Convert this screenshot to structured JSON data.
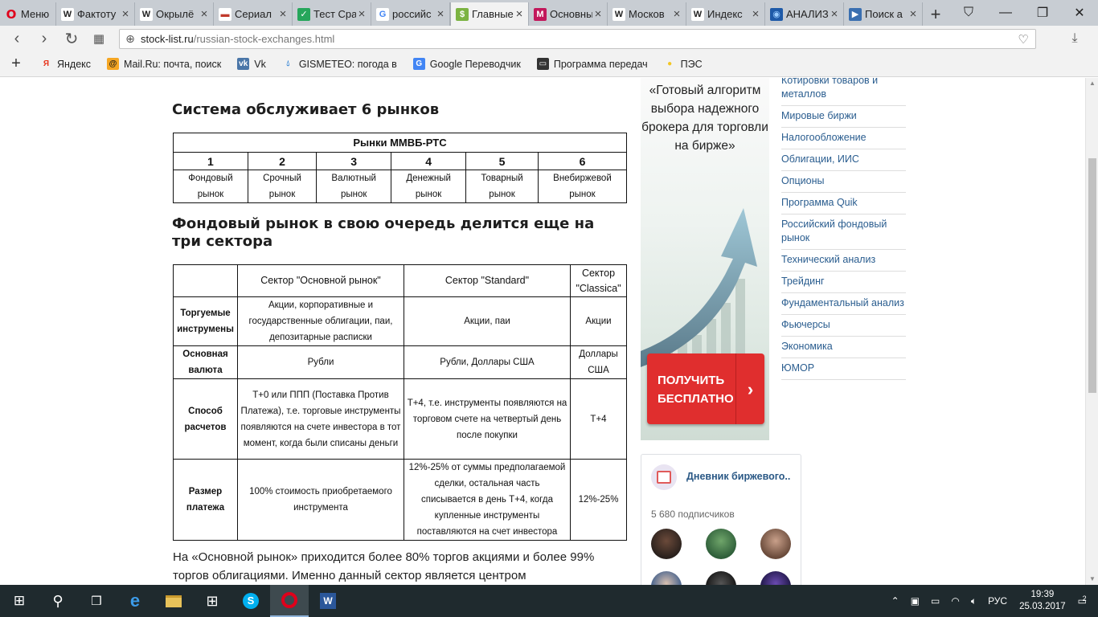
{
  "browser": {
    "menu_label": "Меню",
    "tabs": [
      {
        "label": "Фактоту",
        "icon": "W"
      },
      {
        "label": "Окрылё",
        "icon": "W"
      },
      {
        "label": "Сериал",
        "icon": "flag"
      },
      {
        "label": "Тест Сра",
        "icon": "check"
      },
      {
        "label": "российс",
        "icon": "G"
      },
      {
        "label": "Главные",
        "icon": "$"
      },
      {
        "label": "Основны",
        "icon": "M"
      },
      {
        "label": "Москов",
        "icon": "W"
      },
      {
        "label": "Индекс",
        "icon": "W"
      },
      {
        "label": "АНАЛИЗ",
        "icon": "globe"
      },
      {
        "label": "Поиск а",
        "icon": "play"
      }
    ],
    "url_host": "stock-list.ru",
    "url_path": "/russian-stock-exchanges.html",
    "bookmarks": [
      {
        "label": "Яндекс",
        "icon": "Я"
      },
      {
        "label": "Mail.Ru: почта, поиск",
        "icon": "@"
      },
      {
        "label": "Vk",
        "icon": "vk"
      },
      {
        "label": "GISMETEO: погода в",
        "icon": "drop"
      },
      {
        "label": "Google Переводчик",
        "icon": "G"
      },
      {
        "label": "Программа передач",
        "icon": "tv"
      },
      {
        "label": "ПЭС",
        "icon": "bulb"
      }
    ]
  },
  "page": {
    "heading1": "Система обслуживает 6 рынков",
    "table1": {
      "title": "Рынки ММВБ-РТС",
      "numbers": [
        "1",
        "2",
        "3",
        "4",
        "5",
        "6"
      ],
      "names": [
        "Фондовый рынок",
        "Срочный рынок",
        "Валютный рынок",
        "Денежный рынок",
        "Товарный рынок",
        "Внебиржевой рынок"
      ]
    },
    "heading2": "Фондовый рынок в свою очередь делится еще на три сектора",
    "table2": {
      "columns": [
        "Сектор \"Основной рынок\"",
        "Сектор \"Standard\"",
        "Сектор \"Classica\""
      ],
      "rows": [
        {
          "label": "Торгуемые инструмены",
          "cells": [
            "Акции, корпоративные и государственные облигации, паи, депозитарные расписки",
            "Акции, паи",
            "Акции"
          ]
        },
        {
          "label": "Основная валюта",
          "cells": [
            "Рубли",
            "Рубли, Доллары США",
            "Доллары США"
          ]
        },
        {
          "label": "Способ расчетов",
          "cells": [
            "Т+0 или ППП (Поставка Против Платежа), т.е. торговые инструменты появляются на счете инвестора в тот момент, когда были списаны деньги",
            "Т+4, т.е. инструменты появляются на торговом счете на четвертый день после покупки",
            "Т+4"
          ]
        },
        {
          "label": "Размер платежа",
          "cells": [
            "100% стоимость приобретаемого инструмента",
            "12%-25% от суммы предполагаемой сделки, остальная часть списывается в день Т+4, когда купленные инструменты поставляются на счет инвестора",
            "12%-25%"
          ]
        }
      ]
    },
    "paragraph": "На «Основной рынок» приходится более 80% торгов акциями и более 99% торгов облигациями. Именно данный сектор является центром"
  },
  "promo": {
    "text": "«Готовый алгоритм выбора надежного брокера для торговли на бирже»",
    "button": "ПОЛУЧИТЬ БЕСПЛАТНО"
  },
  "categories": [
    "Котировки товаров и металлов",
    "Мировые биржи",
    "Налогообложение",
    "Облигации, ИИС",
    "Опционы",
    "Программа Quik",
    "Российский фондовый рынок",
    "Технический анализ",
    "Трейдинг",
    "Фундаментальный анализ",
    "Фьючерсы",
    "Экономика",
    "ЮМОР"
  ],
  "vk_widget": {
    "title": "Дневник биржевого..",
    "subscribers": "5 680 подписчиков"
  },
  "taskbar": {
    "lang": "РУС",
    "time": "19:39",
    "date": "25.03.2017",
    "notifications": "2"
  }
}
